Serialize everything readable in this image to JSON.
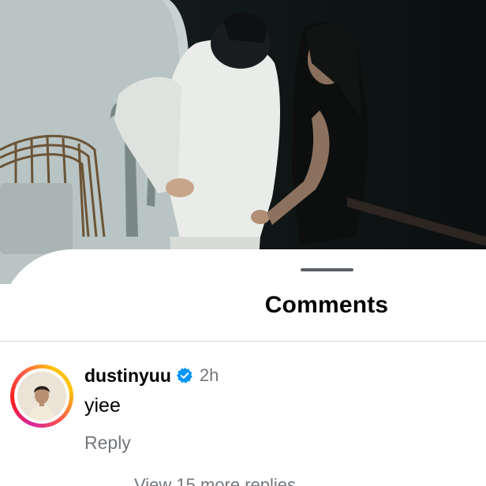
{
  "sheet": {
    "title": "Comments"
  },
  "comment": {
    "username": "dustinyuu",
    "verified_icon": "verified-badge-icon",
    "time": "2h",
    "text": "yiee",
    "reply_label": "Reply",
    "view_replies_label": "View 15 more replies"
  },
  "colors": {
    "verified_blue": "#0095f6",
    "secondary_text": "#73777b",
    "handle": "#5c6064",
    "divider": "#dbdbdb"
  }
}
